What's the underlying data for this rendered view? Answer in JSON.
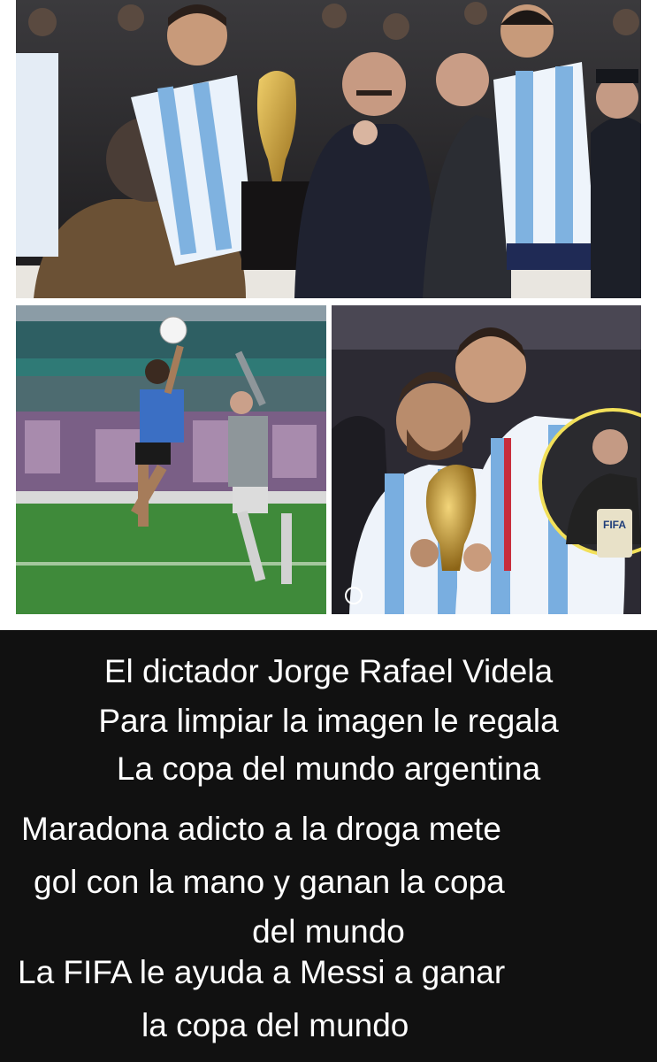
{
  "caption": {
    "lines": [
      "El dictador  Jorge Rafael Videla",
      "Para limpiar la imagen le regala",
      "La copa del mundo argentina",
      "Maradona adicto a la droga mete",
      "gol con la mano y ganan la copa",
      "del mundo",
      "La FIFA le ayuda a Messi a ganar",
      "la copa del mundo"
    ]
  },
  "photos": {
    "top": "photo-1978-trophy-ceremony",
    "bottom_left": "photo-1986-hand-of-god-goal",
    "bottom_right": "photo-2022-messi-di-maria-trophy"
  },
  "inset_badge_text": "FIFA",
  "colors": {
    "caption_bg": "#111111",
    "caption_text": "#ffffff",
    "albiceleste_blue": "#6fa8dc",
    "trophy_gold": "#c99a2e",
    "pitch_green": "#3f8a3a"
  }
}
